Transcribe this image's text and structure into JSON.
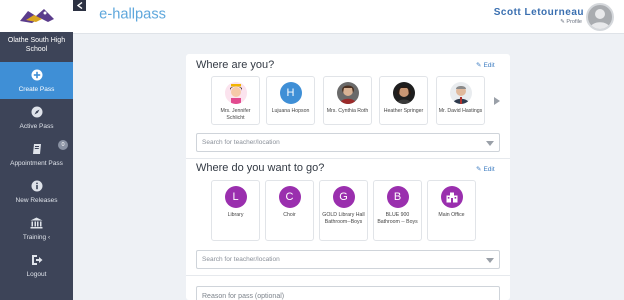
{
  "sidebar": {
    "school_name": "Olathe South High School",
    "items": [
      {
        "label": "Create Pass",
        "icon": "plus-circle-icon",
        "active": true
      },
      {
        "label": "Active Pass",
        "icon": "compass-icon"
      },
      {
        "label": "Appointment Pass",
        "icon": "book-icon",
        "badge": "0"
      },
      {
        "label": "New Releases",
        "icon": "info-circle-icon"
      },
      {
        "label": "Training ‹",
        "icon": "bank-icon"
      },
      {
        "label": "Logout",
        "icon": "sign-out-icon"
      }
    ]
  },
  "header": {
    "brand": "e-hallpass",
    "user_name": "Scott Letourneau",
    "profile_label": "Profile"
  },
  "where_are_you": {
    "title": "Where are you?",
    "edit_label": "Edit",
    "teachers": [
      {
        "name": "Mrs. Jennifer Schlicht",
        "avatar_type": "cartoon"
      },
      {
        "name": "Lujuana Hopson",
        "avatar_type": "initial",
        "initial": "H"
      },
      {
        "name": "Mrs. Cynthia Roth",
        "avatar_type": "photo"
      },
      {
        "name": "Heather Springer",
        "avatar_type": "photo"
      },
      {
        "name": "Mr. David Hastings",
        "avatar_type": "photo"
      }
    ],
    "search_placeholder": "Search for teacher/location"
  },
  "where_to_go": {
    "title": "Where do you want to go?",
    "edit_label": "Edit",
    "destinations": [
      {
        "letter": "L",
        "name": "Library"
      },
      {
        "letter": "C",
        "name": "Choir"
      },
      {
        "letter": "G",
        "name": "GOLD Library Hall Bathroom--Boys"
      },
      {
        "letter": "B",
        "name": "BLUE 900 Bathroom -- Boys"
      },
      {
        "letter": "",
        "name": "Main Office",
        "icon": "office-icon"
      }
    ],
    "search_placeholder": "Search for teacher/location"
  },
  "reason": {
    "placeholder": "Reason for pass (optional)"
  },
  "colors": {
    "sidebar": "#3d4458",
    "active": "#3f8fd6",
    "destination": "#9a2fae",
    "brand_blue": "#3a6fb0"
  }
}
